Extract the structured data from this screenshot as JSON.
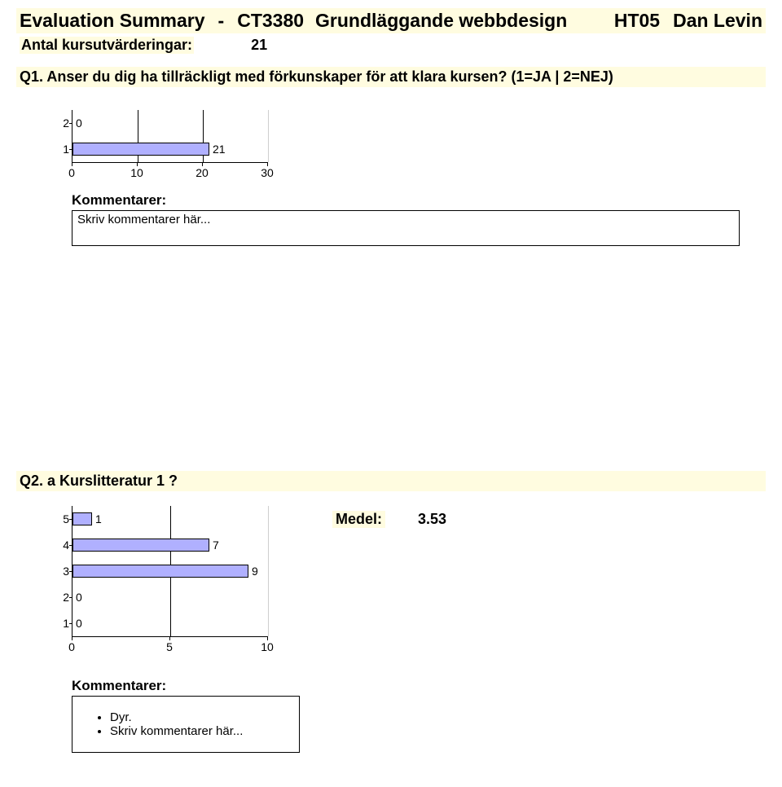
{
  "header": {
    "title": "Evaluation Summary",
    "separator": "-",
    "course_code": "CT3380",
    "course_name": "Grundläggande webbdesign",
    "term": "HT05",
    "teacher": "Dan Levin"
  },
  "count": {
    "label": "Antal kursutvärderingar:",
    "value": "21"
  },
  "q1": {
    "text": "Q1. Anser du dig ha tillräckligt med förkunskaper för att klara kursen? (1=JA | 2=NEJ)",
    "comments_label": "Kommentarer:",
    "comments_text": "Skriv kommentarer här..."
  },
  "q2": {
    "text": "Q2. a Kurslitteratur 1 ?",
    "medel_label": "Medel:",
    "medel_value": "3.53",
    "comments_label": "Kommentarer:",
    "comment_items": [
      "Dyr.",
      "Skriv kommentarer här..."
    ]
  },
  "chart_data": [
    {
      "type": "bar",
      "orientation": "horizontal",
      "categories": [
        "2",
        "1"
      ],
      "values": [
        0,
        21
      ],
      "xticks": [
        0,
        10,
        20,
        30
      ],
      "xlim": [
        0,
        30
      ],
      "title": "",
      "xlabel": "",
      "ylabel": ""
    },
    {
      "type": "bar",
      "orientation": "horizontal",
      "categories": [
        "5",
        "4",
        "3",
        "2",
        "1"
      ],
      "values": [
        1,
        7,
        9,
        0,
        0
      ],
      "xticks": [
        0,
        5,
        10
      ],
      "xlim": [
        0,
        10
      ],
      "title": "",
      "xlabel": "",
      "ylabel": ""
    }
  ]
}
